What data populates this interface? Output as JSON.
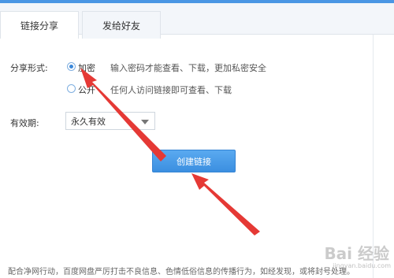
{
  "tabs": [
    {
      "label": "链接分享",
      "active": true
    },
    {
      "label": "发给好友",
      "active": false
    }
  ],
  "form": {
    "share_type_label": "分享形式:",
    "options": [
      {
        "label": "加密",
        "hint": "输入密码才能查看、下载，更加私密安全",
        "selected": true
      },
      {
        "label": "公开",
        "hint": "任何人访问链接即可查看、下载",
        "selected": false
      }
    ],
    "validity_label": "有效期:",
    "validity_value": "永久有效",
    "create_button": "创建链接"
  },
  "notice": "配合净网行动，百度网盘严厉打击不良信息、色情低俗信息的传播行为，如经发现，或将封号处理。",
  "watermark": {
    "text": "Bai 经验",
    "sub": "jingyan.baidu.com"
  },
  "colors": {
    "accent": "#3b8fe0",
    "arrow": "#e53935"
  },
  "icons": [
    "radio-checked-icon",
    "radio-unchecked-icon",
    "dropdown-caret-icon",
    "red-arrow-icon"
  ]
}
